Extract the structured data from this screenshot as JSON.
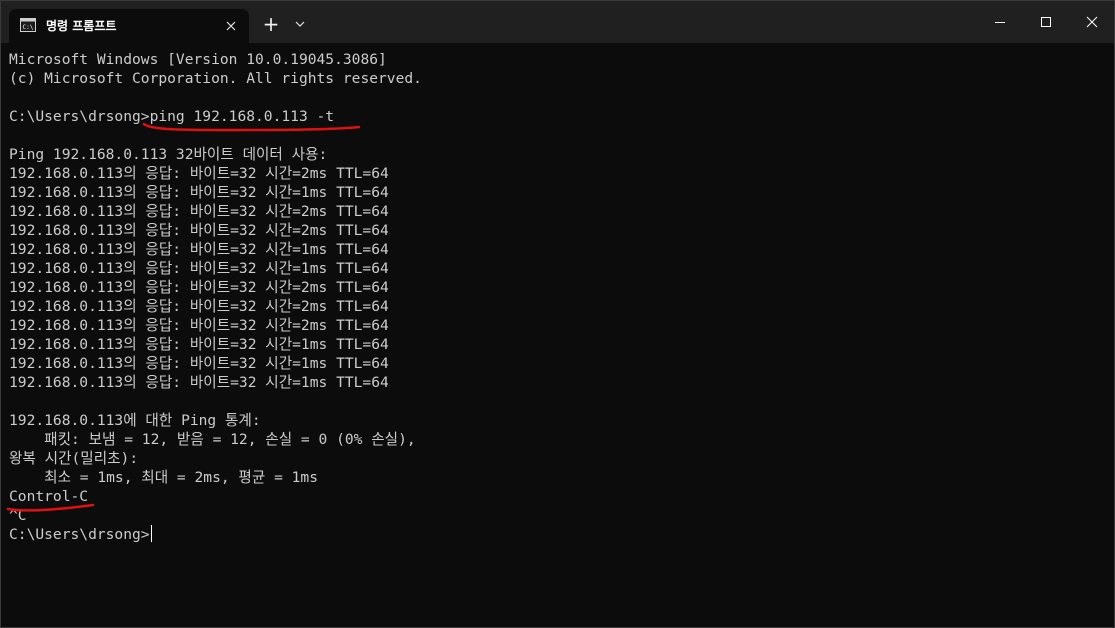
{
  "window": {
    "tab_title": "명령 프롬프트",
    "tab_icon": "terminal-icon",
    "new_tab_label": "+",
    "dropdown_icon": "chevron-down-icon",
    "controls": [
      "minimize-icon",
      "maximize-icon",
      "close-icon"
    ]
  },
  "terminal": {
    "lines": [
      "Microsoft Windows [Version 10.0.19045.3086]",
      "(c) Microsoft Corporation. All rights reserved.",
      "",
      "C:\\Users\\drsong>ping 192.168.0.113 -t",
      "",
      "Ping 192.168.0.113 32바이트 데이터 사용:",
      "192.168.0.113의 응답: 바이트=32 시간=2ms TTL=64",
      "192.168.0.113의 응답: 바이트=32 시간=1ms TTL=64",
      "192.168.0.113의 응답: 바이트=32 시간=2ms TTL=64",
      "192.168.0.113의 응답: 바이트=32 시간=2ms TTL=64",
      "192.168.0.113의 응답: 바이트=32 시간=1ms TTL=64",
      "192.168.0.113의 응답: 바이트=32 시간=1ms TTL=64",
      "192.168.0.113의 응답: 바이트=32 시간=2ms TTL=64",
      "192.168.0.113의 응답: 바이트=32 시간=2ms TTL=64",
      "192.168.0.113의 응답: 바이트=32 시간=2ms TTL=64",
      "192.168.0.113의 응답: 바이트=32 시간=1ms TTL=64",
      "192.168.0.113의 응답: 바이트=32 시간=1ms TTL=64",
      "192.168.0.113의 응답: 바이트=32 시간=1ms TTL=64",
      "",
      "192.168.0.113에 대한 Ping 통계:",
      "    패킷: 보냄 = 12, 받음 = 12, 손실 = 0 (0% 손실),",
      "왕복 시간(밀리초):",
      "    최소 = 1ms, 최대 = 2ms, 평균 = 1ms",
      "Control-C",
      "^C",
      "C:\\Users\\drsong>"
    ]
  },
  "annotations": {
    "underline_color": "#e01010"
  }
}
